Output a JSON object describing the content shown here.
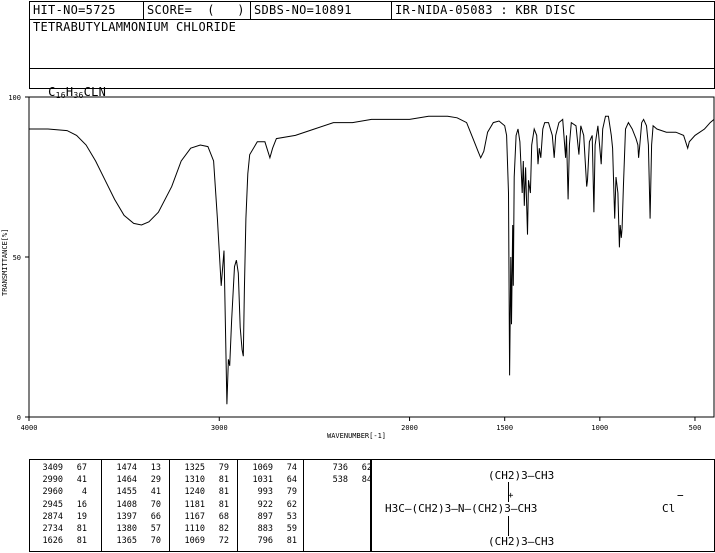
{
  "header": {
    "hit_no": "HIT-NO=5725",
    "score": "SCORE=  (   )",
    "sdbs_no": "SDBS-NO=10891",
    "ir_id": "IR-NIDA-05083 : KBR DISC"
  },
  "compound": {
    "name": "TETRABUTYLAMMONIUM CHLORIDE",
    "formula_parts": [
      "C",
      "16",
      "H",
      "36",
      "CLN"
    ]
  },
  "chart_data": {
    "type": "line",
    "xlabel": "WAVENUMBER[-1]",
    "ylabel": "TRANSMITTANCE[%]",
    "xlim": [
      4000,
      400
    ],
    "ylim": [
      0,
      100
    ],
    "x_ticks": [
      4000,
      3000,
      2000,
      1500,
      1000,
      500
    ],
    "y_ticks": [
      0,
      50,
      100
    ],
    "series": [
      {
        "color": "#000000",
        "points": [
          [
            4000,
            90
          ],
          [
            3900,
            90
          ],
          [
            3800,
            89.5
          ],
          [
            3750,
            88
          ],
          [
            3700,
            85
          ],
          [
            3650,
            80
          ],
          [
            3600,
            74
          ],
          [
            3550,
            68
          ],
          [
            3500,
            63
          ],
          [
            3450,
            60.5
          ],
          [
            3409,
            60
          ],
          [
            3370,
            61
          ],
          [
            3320,
            64
          ],
          [
            3250,
            72
          ],
          [
            3200,
            80
          ],
          [
            3150,
            84
          ],
          [
            3100,
            85
          ],
          [
            3060,
            84.5
          ],
          [
            3030,
            80
          ],
          [
            3010,
            62
          ],
          [
            2990,
            41
          ],
          [
            2975,
            52
          ],
          [
            2960,
            4
          ],
          [
            2952,
            18
          ],
          [
            2945,
            16
          ],
          [
            2935,
            30
          ],
          [
            2920,
            47
          ],
          [
            2910,
            49
          ],
          [
            2900,
            45
          ],
          [
            2890,
            28
          ],
          [
            2880,
            21
          ],
          [
            2874,
            19
          ],
          [
            2868,
            40
          ],
          [
            2860,
            62
          ],
          [
            2850,
            76
          ],
          [
            2840,
            82
          ],
          [
            2800,
            86
          ],
          [
            2760,
            86
          ],
          [
            2734,
            81
          ],
          [
            2720,
            84
          ],
          [
            2700,
            87
          ],
          [
            2600,
            88
          ],
          [
            2500,
            90
          ],
          [
            2400,
            92
          ],
          [
            2300,
            92
          ],
          [
            2200,
            93
          ],
          [
            2100,
            93
          ],
          [
            2000,
            93
          ],
          [
            1900,
            94
          ],
          [
            1800,
            94
          ],
          [
            1750,
            93.5
          ],
          [
            1700,
            92
          ],
          [
            1660,
            86
          ],
          [
            1640,
            83
          ],
          [
            1626,
            81
          ],
          [
            1610,
            83
          ],
          [
            1590,
            89
          ],
          [
            1560,
            92
          ],
          [
            1530,
            92.5
          ],
          [
            1500,
            91
          ],
          [
            1490,
            88
          ],
          [
            1480,
            70
          ],
          [
            1474,
            13
          ],
          [
            1468,
            50
          ],
          [
            1464,
            29
          ],
          [
            1458,
            60
          ],
          [
            1455,
            41
          ],
          [
            1450,
            75
          ],
          [
            1440,
            88
          ],
          [
            1430,
            90
          ],
          [
            1420,
            86
          ],
          [
            1408,
            70
          ],
          [
            1402,
            80
          ],
          [
            1397,
            66
          ],
          [
            1390,
            78
          ],
          [
            1380,
            57
          ],
          [
            1375,
            74
          ],
          [
            1365,
            70
          ],
          [
            1358,
            85
          ],
          [
            1345,
            90
          ],
          [
            1332,
            88
          ],
          [
            1325,
            79
          ],
          [
            1318,
            84
          ],
          [
            1310,
            81
          ],
          [
            1300,
            90
          ],
          [
            1290,
            92
          ],
          [
            1270,
            92
          ],
          [
            1250,
            88
          ],
          [
            1240,
            81
          ],
          [
            1232,
            88
          ],
          [
            1215,
            92
          ],
          [
            1195,
            93
          ],
          [
            1180,
            81
          ],
          [
            1175,
            88
          ],
          [
            1167,
            68
          ],
          [
            1160,
            85
          ],
          [
            1150,
            92
          ],
          [
            1125,
            91
          ],
          [
            1110,
            82
          ],
          [
            1100,
            91
          ],
          [
            1085,
            88
          ],
          [
            1069,
            72
          ],
          [
            1065,
            74
          ],
          [
            1055,
            86
          ],
          [
            1040,
            88
          ],
          [
            1031,
            64
          ],
          [
            1025,
            85
          ],
          [
            1010,
            91
          ],
          [
            993,
            79
          ],
          [
            985,
            90
          ],
          [
            970,
            94
          ],
          [
            955,
            94
          ],
          [
            940,
            88
          ],
          [
            933,
            84
          ],
          [
            922,
            62
          ],
          [
            915,
            75
          ],
          [
            905,
            70
          ],
          [
            897,
            53
          ],
          [
            893,
            60
          ],
          [
            887,
            56
          ],
          [
            883,
            59
          ],
          [
            876,
            72
          ],
          [
            865,
            90
          ],
          [
            850,
            92
          ],
          [
            830,
            90
          ],
          [
            810,
            87
          ],
          [
            800,
            85
          ],
          [
            796,
            81
          ],
          [
            790,
            85
          ],
          [
            780,
            92
          ],
          [
            770,
            93
          ],
          [
            755,
            91
          ],
          [
            745,
            85
          ],
          [
            736,
            62
          ],
          [
            728,
            85
          ],
          [
            720,
            91
          ],
          [
            700,
            90
          ],
          [
            650,
            89
          ],
          [
            600,
            89
          ],
          [
            560,
            88
          ],
          [
            538,
            84
          ],
          [
            530,
            86
          ],
          [
            500,
            88
          ],
          [
            450,
            90
          ],
          [
            420,
            92
          ],
          [
            400,
            93
          ]
        ]
      }
    ]
  },
  "peak_table": [
    [
      [
        "3409",
        "67"
      ],
      [
        "2990",
        "41"
      ],
      [
        "2960",
        "4"
      ],
      [
        "2945",
        "16"
      ],
      [
        "2874",
        "19"
      ],
      [
        "2734",
        "81"
      ],
      [
        "1626",
        "81"
      ]
    ],
    [
      [
        "1474",
        "13"
      ],
      [
        "1464",
        "29"
      ],
      [
        "1455",
        "41"
      ],
      [
        "1408",
        "70"
      ],
      [
        "1397",
        "66"
      ],
      [
        "1380",
        "57"
      ],
      [
        "1365",
        "70"
      ]
    ],
    [
      [
        "1325",
        "79"
      ],
      [
        "1310",
        "81"
      ],
      [
        "1240",
        "81"
      ],
      [
        "1181",
        "81"
      ],
      [
        "1167",
        "68"
      ],
      [
        "1110",
        "82"
      ],
      [
        "1069",
        "72"
      ]
    ],
    [
      [
        "1069",
        "74"
      ],
      [
        "1031",
        "64"
      ],
      [
        "993",
        "79"
      ],
      [
        "922",
        "62"
      ],
      [
        "897",
        "53"
      ],
      [
        "883",
        "59"
      ],
      [
        "796",
        "81"
      ]
    ],
    [
      [
        "736",
        "62"
      ],
      [
        "538",
        "84"
      ]
    ]
  ],
  "structure": {
    "top": "(CH2)3—CH3",
    "left": "H3C—(CH2)3—N—(CH2)3—CH3",
    "bottom": "(CH2)3—CH3",
    "charge_plus": "+",
    "counter_ion": "Cl",
    "charge_minus": "−"
  }
}
